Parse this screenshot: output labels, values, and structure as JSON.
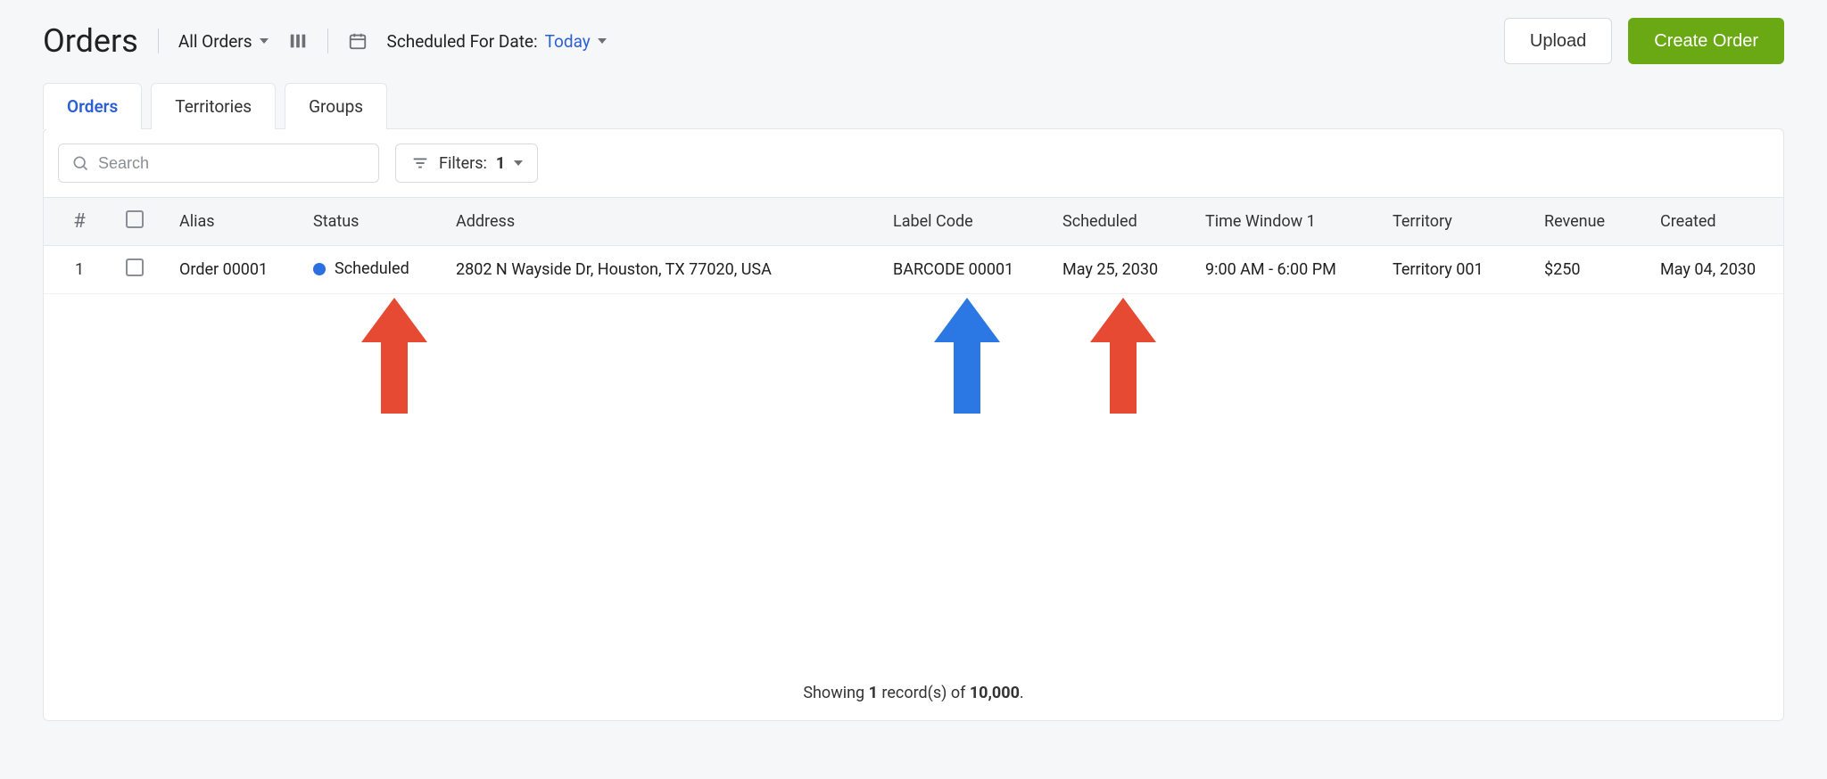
{
  "header": {
    "title": "Orders",
    "allOrders": "All Orders",
    "scheduledForLabel": "Scheduled For Date:",
    "scheduledForValue": "Today",
    "uploadLabel": "Upload",
    "createLabel": "Create Order"
  },
  "tabs": {
    "orders": "Orders",
    "territories": "Territories",
    "groups": "Groups"
  },
  "toolbar": {
    "searchPlaceholder": "Search",
    "filtersLabel": "Filters:",
    "filtersCount": "1"
  },
  "columns": {
    "num": "#",
    "alias": "Alias",
    "status": "Status",
    "address": "Address",
    "labelCode": "Label Code",
    "scheduled": "Scheduled",
    "timeWindow": "Time Window 1",
    "territory": "Territory",
    "revenue": "Revenue",
    "created": "Created"
  },
  "rows": [
    {
      "num": "1",
      "alias": "Order 00001",
      "status": "Scheduled",
      "address": "2802 N Wayside Dr, Houston, TX 77020, USA",
      "labelCode": "BARCODE 00001",
      "scheduled": "May 25, 2030",
      "timeWindow": "9:00 AM - 6:00 PM",
      "territory": "Territory 001",
      "revenue": "$250",
      "created": "May 04, 2030"
    }
  ],
  "footer": {
    "prefix": "Showing ",
    "shown": "1",
    "middle": " record(s) of ",
    "total": "10,000",
    "suffix": "."
  },
  "annotations": {
    "arrowColors": {
      "red": "#e64a32",
      "blue": "#2b78e4"
    }
  }
}
